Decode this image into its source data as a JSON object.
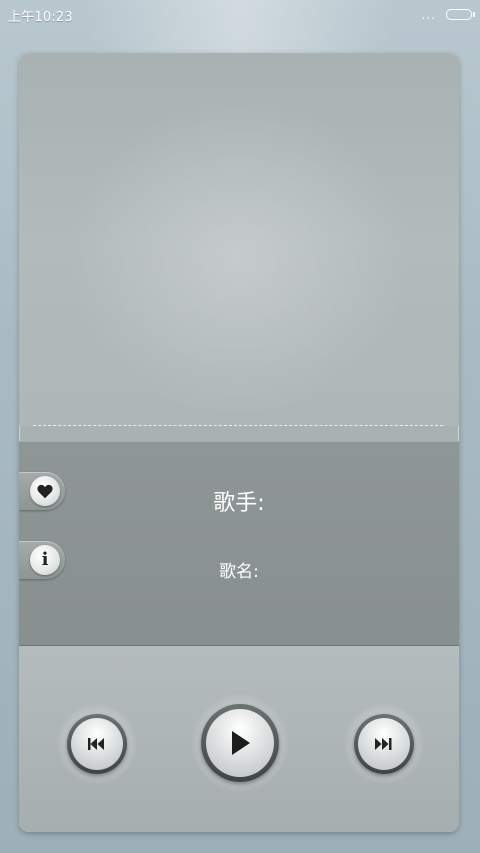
{
  "status_bar": {
    "time": "上午10:23",
    "dots": "...",
    "battery_icon": "battery-icon"
  },
  "track_info": {
    "artist_label": "歌手:",
    "title_label": "歌名:"
  },
  "side_buttons": {
    "like_icon": "heart-icon",
    "info_icon": "info-icon",
    "info_glyph": "i"
  },
  "controls": {
    "previous_icon": "skip-previous-icon",
    "play_icon": "play-icon",
    "next_icon": "skip-next-icon"
  },
  "colors": {
    "info_panel": "#888f8f",
    "icon_dark": "#222222",
    "text": "#ffffff"
  }
}
